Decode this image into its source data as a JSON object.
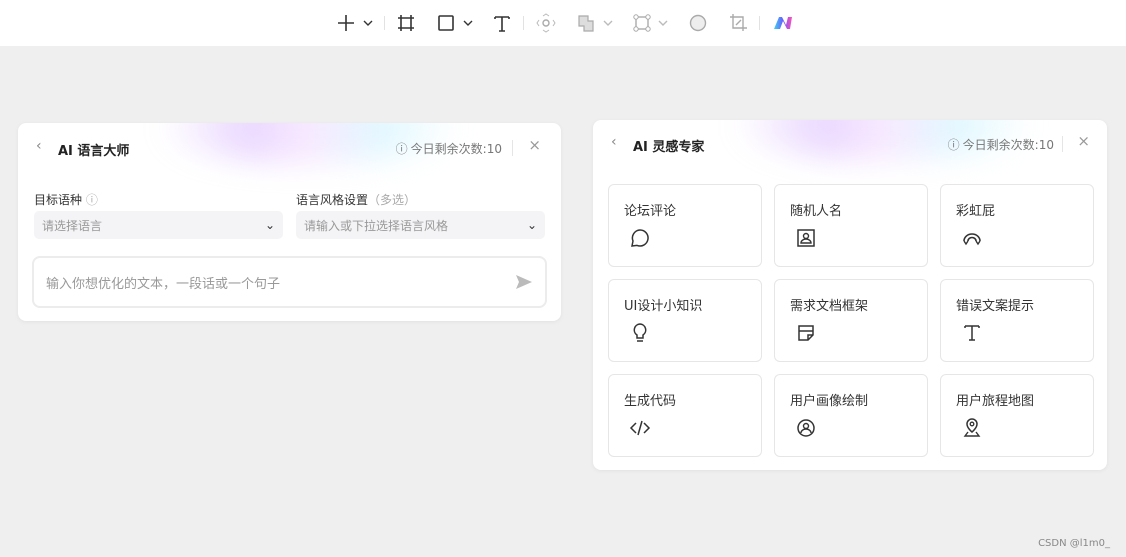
{
  "toolbar": {
    "items": [
      "add-icon",
      "frame-icon",
      "rectangle-icon",
      "text-icon",
      "component-icon",
      "boolean-icon",
      "path-icon",
      "ellipse-icon",
      "crop-icon",
      "ai-logo-icon"
    ]
  },
  "language_panel": {
    "back": "‹",
    "title": "AI 语言大师",
    "quota": "今日剩余次数:10",
    "close": "×",
    "target_label": "目标语种",
    "style_label": "语言风格设置",
    "style_hint": "（多选）",
    "target_placeholder": "请选择语言",
    "style_placeholder": "请输入或下拉选择语言风格",
    "text_placeholder": "输入你想优化的文本，一段话或一个句子"
  },
  "inspiration_panel": {
    "back": "‹",
    "title": "AI 灵感专家",
    "quota": "今日剩余次数:10",
    "close": "×",
    "tiles": [
      {
        "label": "论坛评论",
        "icon": "chat-bubble-icon"
      },
      {
        "label": "随机人名",
        "icon": "contact-card-icon"
      },
      {
        "label": "彩虹屁",
        "icon": "rainbow-icon"
      },
      {
        "label": "UI设计小知识",
        "icon": "lightbulb-icon"
      },
      {
        "label": "需求文档框架",
        "icon": "note-icon"
      },
      {
        "label": "错误文案提示",
        "icon": "text-icon"
      },
      {
        "label": "生成代码",
        "icon": "code-icon"
      },
      {
        "label": "用户画像绘制",
        "icon": "user-circle-icon"
      },
      {
        "label": "用户旅程地图",
        "icon": "map-pin-icon"
      }
    ]
  },
  "watermark": "CSDN @l1m0_"
}
